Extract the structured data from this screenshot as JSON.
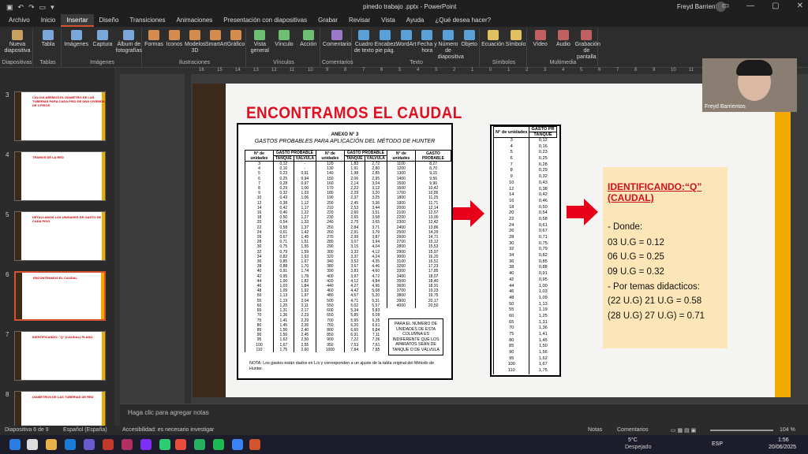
{
  "titlebar": {
    "doc_title": "pinedo trabajo .pptx - PowerPoint",
    "user": "Freyd Barrientos"
  },
  "tabs": [
    "Archivo",
    "Inicio",
    "Insertar",
    "Diseño",
    "Transiciones",
    "Animaciones",
    "Presentación con diapositivas",
    "Grabar",
    "Revisar",
    "Vista",
    "Ayuda",
    "¿Qué desea hacer?"
  ],
  "ribbon": {
    "groups": [
      {
        "label": "Diapositivas",
        "items": [
          "Nueva diapositiva"
        ]
      },
      {
        "label": "Tablas",
        "items": [
          "Tabla"
        ]
      },
      {
        "label": "Imágenes",
        "items": [
          "Imágenes",
          "Captura",
          "Álbum de fotografías"
        ]
      },
      {
        "label": "Ilustraciones",
        "items": [
          "Formas",
          "Iconos",
          "Modelos 3D",
          "SmartArt",
          "Gráfico"
        ]
      },
      {
        "label": "Vínculos",
        "items": [
          "Vista general",
          "Vínculo",
          "Acción"
        ]
      },
      {
        "label": "Comentarios",
        "items": [
          "Comentario"
        ]
      },
      {
        "label": "Texto",
        "items": [
          "Cuadro de texto",
          "Encabez. pie pág.",
          "WordArt",
          "Fecha y hora",
          "Número de diapositiva",
          "Objeto"
        ]
      },
      {
        "label": "Símbolos",
        "items": [
          "Ecuación",
          "Símbolo"
        ]
      },
      {
        "label": "Multimedia",
        "items": [
          "Vídeo",
          "Audio",
          "Grabación de pantalla"
        ]
      }
    ]
  },
  "thumbnails": [
    {
      "num": "3",
      "title": "CALCULAREMOS EL DIAMETRO DE LAS TUBERIAS PARA CADA PISO DE UNA VIVIENDA DE 3 PISOS"
    },
    {
      "num": "4",
      "title": "TRAMOS DE LA RED"
    },
    {
      "num": "5",
      "title": "DETALLAMOS LAS UNIDADES DE GASTO DE CADA PISO"
    },
    {
      "num": "6",
      "title": "ENCONTRAMOS EL CAUDAL"
    },
    {
      "num": "7",
      "title": "IDENTIFICANDO: \"Q\" (CAUDAL) PLANO"
    },
    {
      "num": "8",
      "title": "DIAMETROS DE LAS TUBERIAS DE RED"
    }
  ],
  "slide": {
    "title": "ENCONTRAMOS EL CAUDAL",
    "annex": "ANEXO N° 3",
    "annex_title": "GASTOS PROBABLES PARA APLICACIÓN DEL MÉTODO DE HUNTER",
    "headers": [
      "N° de unidades",
      "GASTO PROBABLE",
      "N° de unidades",
      "GASTO PROBABLE",
      "N° de unidades",
      "GASTO PROBABLE"
    ],
    "subheaders": [
      "",
      "TANQUE",
      "VÁLVULA",
      "",
      "TANQUE",
      "VÁLVULA",
      "",
      ""
    ],
    "col1": [
      [
        "3",
        "0,12",
        "-"
      ],
      [
        "4",
        "0,16",
        "-"
      ],
      [
        "5",
        "0,23",
        "0,91"
      ],
      [
        "6",
        "0,25",
        "0,94"
      ],
      [
        "7",
        "0,28",
        "0,97"
      ],
      [
        "8",
        "0,29",
        "1,00"
      ],
      [
        "9",
        "0,32",
        "1,03"
      ],
      [
        "10",
        "0,43",
        "1,06"
      ],
      [
        "12",
        "0,38",
        "1,12"
      ],
      [
        "14",
        "0,42",
        "1,17"
      ],
      [
        "16",
        "0,46",
        "1,22"
      ],
      [
        "18",
        "0,50",
        "1,27"
      ],
      [
        "20",
        "0,54",
        "1,33"
      ],
      [
        "22",
        "0,58",
        "1,37"
      ],
      [
        "24",
        "0,61",
        "1,42"
      ],
      [
        "26",
        "0,67",
        "1,45"
      ],
      [
        "28",
        "0,71",
        "1,51"
      ],
      [
        "30",
        "0,75",
        "1,55"
      ],
      [
        "32",
        "0,79",
        "1,59"
      ],
      [
        "34",
        "0,82",
        "1,63"
      ],
      [
        "36",
        "0,85",
        "1,67"
      ],
      [
        "38",
        "0,88",
        "1,70"
      ],
      [
        "40",
        "0,91",
        "1,74"
      ],
      [
        "42",
        "0,95",
        "1,78"
      ],
      [
        "44",
        "1,00",
        "1,82"
      ],
      [
        "46",
        "1,03",
        "1,84"
      ],
      [
        "48",
        "1,09",
        "1,92"
      ],
      [
        "50",
        "1,13",
        "1,97"
      ],
      [
        "55",
        "1,19",
        "2,04"
      ],
      [
        "60",
        "1,25",
        "2,11"
      ],
      [
        "65",
        "1,31",
        "2,17"
      ],
      [
        "70",
        "1,36",
        "2,23"
      ],
      [
        "75",
        "1,41",
        "2,29"
      ],
      [
        "80",
        "1,45",
        "2,35"
      ],
      [
        "85",
        "1,50",
        "2,40"
      ],
      [
        "90",
        "1,56",
        "2,45"
      ],
      [
        "95",
        "1,62",
        "2,50"
      ],
      [
        "100",
        "1,67",
        "2,55"
      ],
      [
        "110",
        "1,75",
        "2,60"
      ]
    ],
    "col2": [
      [
        "120",
        "1,83",
        "2,72"
      ],
      [
        "130",
        "1,91",
        "2,80"
      ],
      [
        "140",
        "1,98",
        "2,85"
      ],
      [
        "150",
        "2,06",
        "2,95"
      ],
      [
        "160",
        "2,14",
        "3,04"
      ],
      [
        "170",
        "2,22",
        "3,12"
      ],
      [
        "180",
        "2,29",
        "3,20"
      ],
      [
        "190",
        "2,37",
        "3,25"
      ],
      [
        "200",
        "2,45",
        "3,36"
      ],
      [
        "210",
        "2,53",
        "3,44"
      ],
      [
        "220",
        "2,60",
        "3,51"
      ],
      [
        "230",
        "2,65",
        "3,58"
      ],
      [
        "240",
        "2,75",
        "3,65"
      ],
      [
        "250",
        "2,84",
        "3,71"
      ],
      [
        "260",
        "2,91",
        "3,79"
      ],
      [
        "270",
        "2,99",
        "3,87"
      ],
      [
        "280",
        "3,07",
        "3,94"
      ],
      [
        "290",
        "3,15",
        "4,04"
      ],
      [
        "300",
        "3,32",
        "4,12"
      ],
      [
        "320",
        "3,37",
        "4,24"
      ],
      [
        "340",
        "3,52",
        "4,35"
      ],
      [
        "380",
        "3,67",
        "4,46"
      ],
      [
        "390",
        "3,83",
        "4,60"
      ],
      [
        "400",
        "3,97",
        "4,72"
      ],
      [
        "420",
        "4,12",
        "4,84"
      ],
      [
        "440",
        "4,27",
        "4,96"
      ],
      [
        "460",
        "4,42",
        "5,08"
      ],
      [
        "480",
        "4,57",
        "5,20"
      ],
      [
        "500",
        "4,71",
        "5,31"
      ],
      [
        "550",
        "5,02",
        "5,57"
      ],
      [
        "600",
        "5,34",
        "5,83"
      ],
      [
        "650",
        "5,85",
        "6,09"
      ],
      [
        "700",
        "5,95",
        "6,35"
      ],
      [
        "750",
        "6,20",
        "6,61"
      ],
      [
        "800",
        "6,60",
        "6,84"
      ],
      [
        "850",
        "6,91",
        "7,11"
      ],
      [
        "900",
        "7,22",
        "7,36"
      ],
      [
        "950",
        "7,53",
        "7,61"
      ],
      [
        "1000",
        "7,84",
        "7,85"
      ]
    ],
    "col3": [
      [
        "1100",
        "8,27"
      ],
      [
        "1200",
        "8,70"
      ],
      [
        "1300",
        "9,15"
      ],
      [
        "1400",
        "9,56"
      ],
      [
        "1500",
        "9,90"
      ],
      [
        "1600",
        "10,42"
      ],
      [
        "1700",
        "10,85"
      ],
      [
        "1800",
        "11,25"
      ],
      [
        "1900",
        "11,71"
      ],
      [
        "2000",
        "12,14"
      ],
      [
        "2100",
        "12,57"
      ],
      [
        "2200",
        "13,00"
      ],
      [
        "2300",
        "13,42"
      ],
      [
        "2400",
        "13,86"
      ],
      [
        "2500",
        "14,29"
      ],
      [
        "2600",
        "14,71"
      ],
      [
        "2700",
        "15,12"
      ],
      [
        "2800",
        "15,53"
      ],
      [
        "2900",
        "15,97"
      ],
      [
        "3000",
        "16,20"
      ],
      [
        "3100",
        "16,51"
      ],
      [
        "3200",
        "17,23"
      ],
      [
        "3300",
        "17,85"
      ],
      [
        "3400",
        "18,07"
      ],
      [
        "3500",
        "18,40"
      ],
      [
        "3600",
        "18,91"
      ],
      [
        "3700",
        "19,23"
      ],
      [
        "3800",
        "19,75"
      ],
      [
        "3900",
        "20,17"
      ],
      [
        "4000",
        "20,50"
      ]
    ],
    "side_note": "PARA EL NÚMERO DE UNIDADES DE ESTA COLUMNA ES INDIFERENTE QUE LOS APARATOS SEAN DE TANQUE O DE VÁLVULA",
    "note": "NOTA: Los gastos están dados en L/s y corresponden a un ajuste de la tabla original del Método de Hunter.",
    "small_headers": [
      "N° de unidades",
      "GASTO PR",
      "TANQUE"
    ],
    "small_rows": [
      [
        "3",
        "0,12"
      ],
      [
        "4",
        "0,16"
      ],
      [
        "5",
        "0,23"
      ],
      [
        "6",
        "0,25"
      ],
      [
        "7",
        "0,28"
      ],
      [
        "8",
        "0,29"
      ],
      [
        "9",
        "0,32"
      ],
      [
        "10",
        "0,43"
      ],
      [
        "12",
        "0,38"
      ],
      [
        "14",
        "0,42"
      ],
      [
        "16",
        "0,46"
      ],
      [
        "18",
        "0,50"
      ],
      [
        "20",
        "0,54"
      ],
      [
        "22",
        "0,58"
      ],
      [
        "24",
        "0,61"
      ],
      [
        "26",
        "0,67"
      ],
      [
        "28",
        "0,71"
      ],
      [
        "30",
        "0,75"
      ],
      [
        "32",
        "0,79"
      ],
      [
        "34",
        "0,82"
      ],
      [
        "36",
        "0,85"
      ],
      [
        "38",
        "0,88"
      ],
      [
        "40",
        "0,91"
      ],
      [
        "42",
        "0,95"
      ],
      [
        "44",
        "1,00"
      ],
      [
        "46",
        "1,03"
      ],
      [
        "48",
        "1,09"
      ],
      [
        "50",
        "1,13"
      ],
      [
        "55",
        "1,19"
      ],
      [
        "60",
        "1,25"
      ],
      [
        "65",
        "1,31"
      ],
      [
        "70",
        "1,36"
      ],
      [
        "75",
        "1,41"
      ],
      [
        "80",
        "1,45"
      ],
      [
        "85",
        "1,50"
      ],
      [
        "90",
        "1,56"
      ],
      [
        "95",
        "1,62"
      ],
      [
        "100",
        "1,67"
      ],
      [
        "110",
        "1,75"
      ]
    ],
    "box": {
      "heading": "IDENTIFICANDO:“Q” (CAUDAL)",
      "lines": [
        "- Donde:",
        "03 U.G = 0.12",
        "06 U.G = 0.25",
        "09 U.G = 0.32",
        "- Por temas didacticos:",
        "(22 U.G) 21 U.G = 0.58",
        "(28 U.G) 27 U.G) = 0.71"
      ]
    }
  },
  "notes_placeholder": "Haga clic para agregar notas",
  "status": {
    "slide": "Diapositiva 6 de 9",
    "lang": "Español (España)",
    "access": "Accesibilidad: es necesario investigar",
    "notes": "Notas",
    "comments": "Comentarios",
    "zoom": "104 %"
  },
  "taskbar": {
    "weather_temp": "5°C",
    "weather_text": "Despejado",
    "lang": "ESP",
    "time": "1:56",
    "date": "20/06/2025"
  },
  "webcam": {
    "name": "Freyd Barrientos"
  },
  "colors": {
    "accent": "#d35230",
    "title_red": "#e01020",
    "gold": "#f2a900",
    "box_bg": "#fce6b7",
    "brown": "#3b2a1a"
  }
}
